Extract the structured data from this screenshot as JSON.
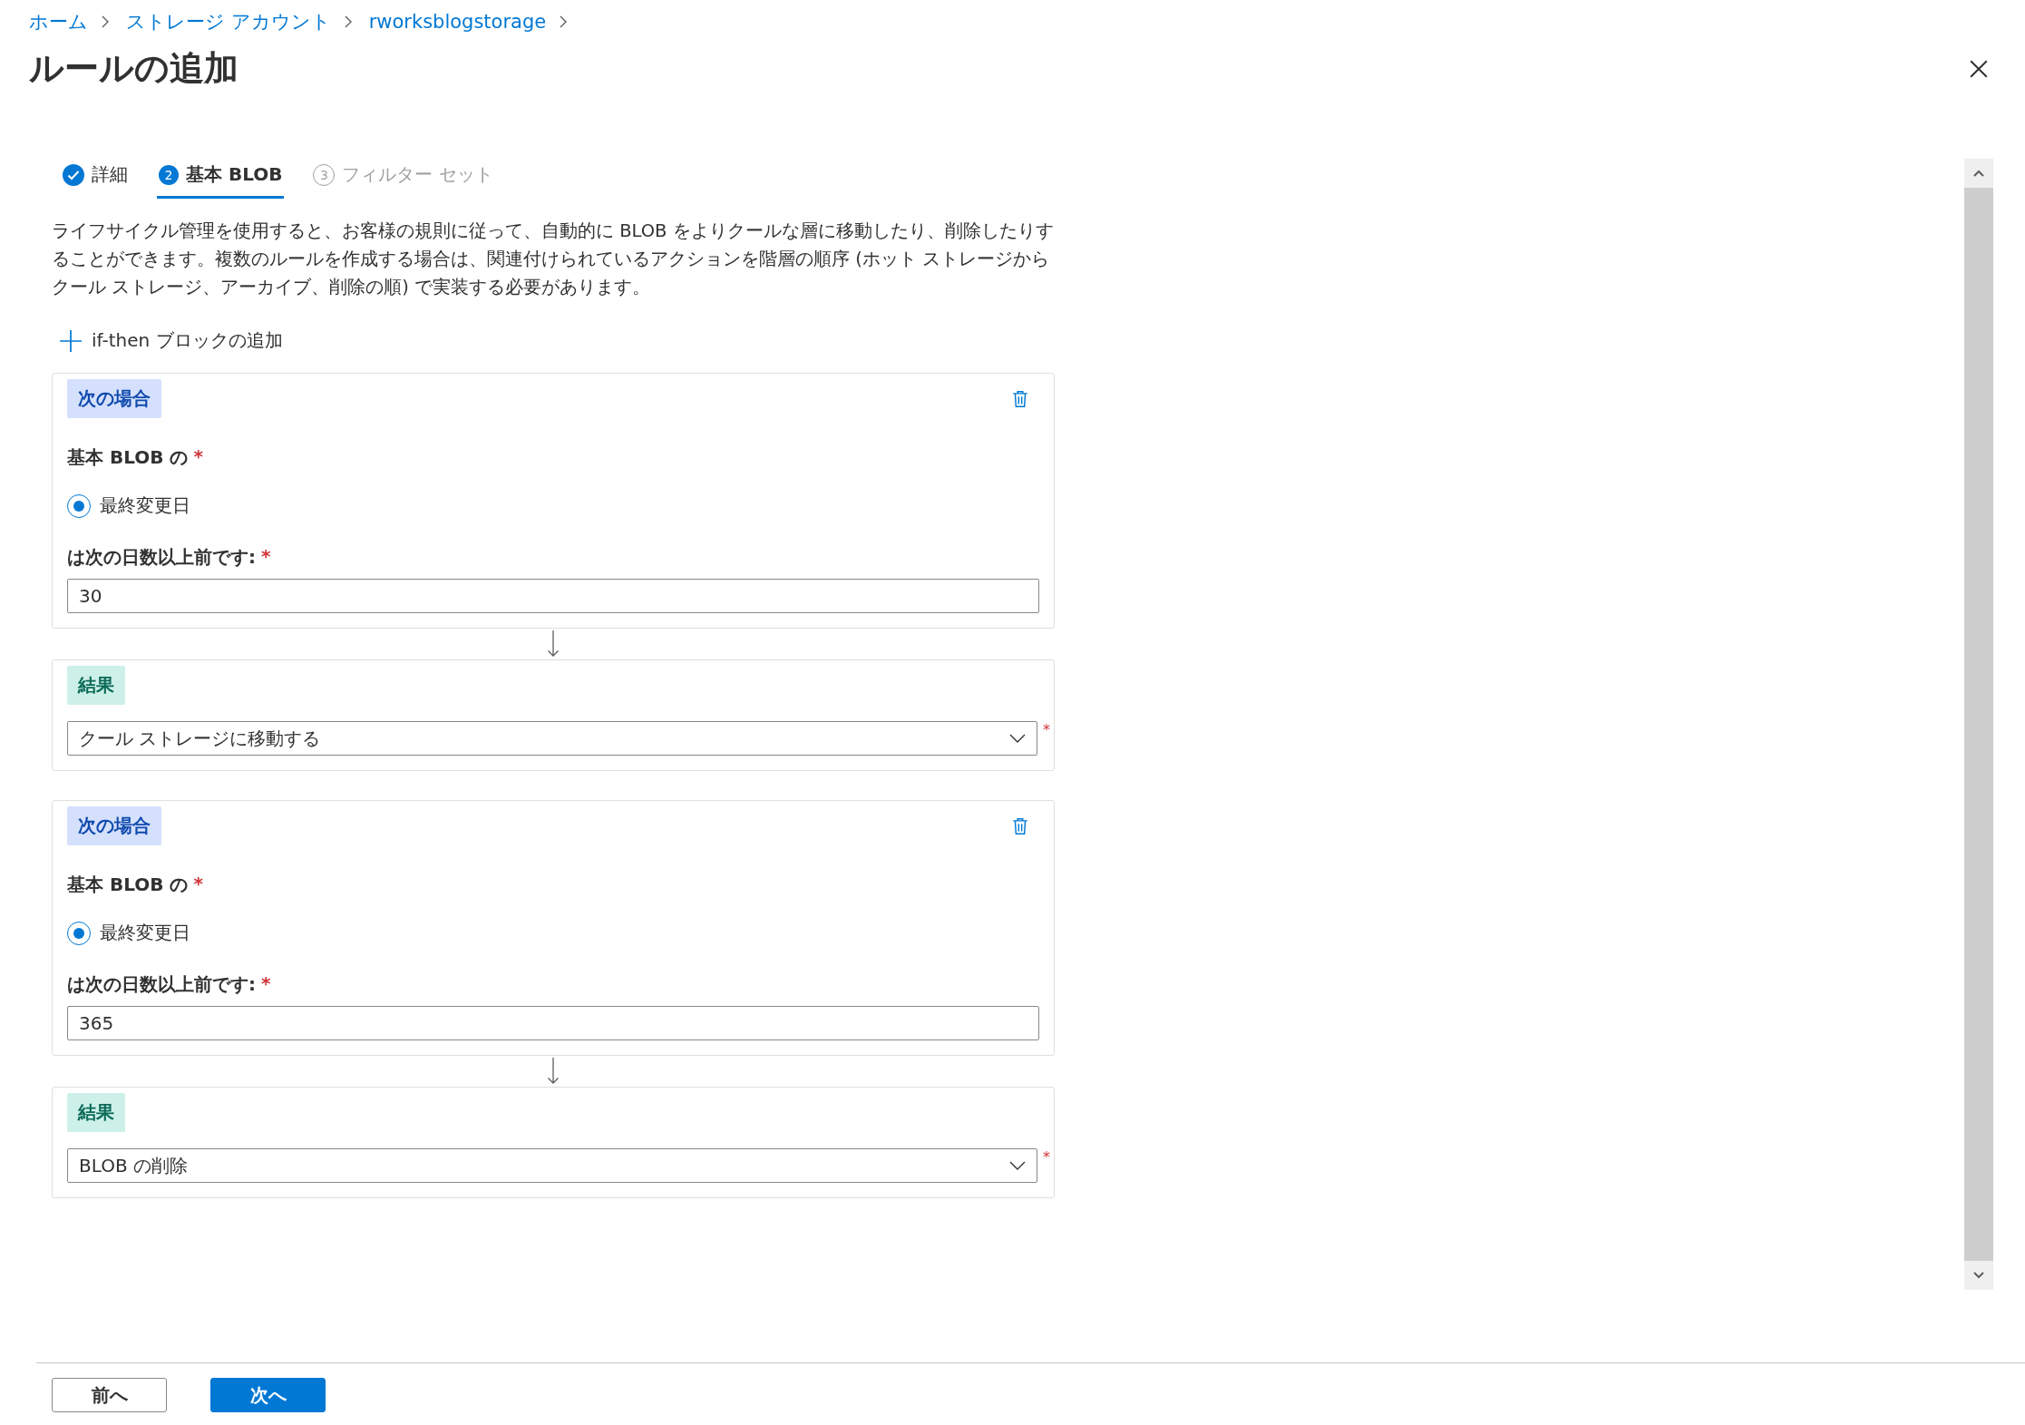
{
  "breadcrumb": [
    {
      "label": "ホーム"
    },
    {
      "label": "ストレージ アカウント"
    },
    {
      "label": "rworksblogstorage"
    }
  ],
  "title": "ルールの追加",
  "steps": [
    {
      "label": "詳細",
      "kind": "check",
      "selected": false,
      "disabled": false
    },
    {
      "label": "基本 BLOB",
      "kind": "number",
      "number": "2",
      "selected": true,
      "disabled": false
    },
    {
      "label": "フィルター セット",
      "kind": "number",
      "number": "3",
      "selected": false,
      "disabled": true
    }
  ],
  "description": "ライフサイクル管理を使用すると、お客様の規則に従って、自動的に BLOB をよりクールな層に移動したり、削除したりすることができます。複数のルールを作成する場合は、関連付けられているアクションを階層の順序 (ホット ストレージからクール ストレージ、アーカイブ、削除の順) で実装する必要があります。",
  "add_block": "if-then ブロックの追加",
  "rules": [
    {
      "condition": {
        "badge": "次の場合",
        "base_label": "基本 BLOB の",
        "base_mark": "*",
        "radio": {
          "label": "最終変更日",
          "selected": true
        },
        "days_label": "は次の日数以上前です:",
        "days_mark": "*",
        "days_value": "30"
      },
      "action": {
        "badge": "結果",
        "value": "クール ストレージに移動する",
        "mark": "*"
      }
    },
    {
      "condition": {
        "badge": "次の場合",
        "base_label": "基本 BLOB の",
        "base_mark": "*",
        "radio": {
          "label": "最終変更日",
          "selected": true
        },
        "days_label": "は次の日数以上前です:",
        "days_mark": "*",
        "days_value": "365"
      },
      "action": {
        "badge": "結果",
        "value": "BLOB の削除",
        "mark": "*"
      }
    }
  ],
  "buttons": [
    {
      "label": "前へ",
      "kind": "secondary"
    },
    {
      "label": "次へ",
      "kind": "primary"
    }
  ]
}
